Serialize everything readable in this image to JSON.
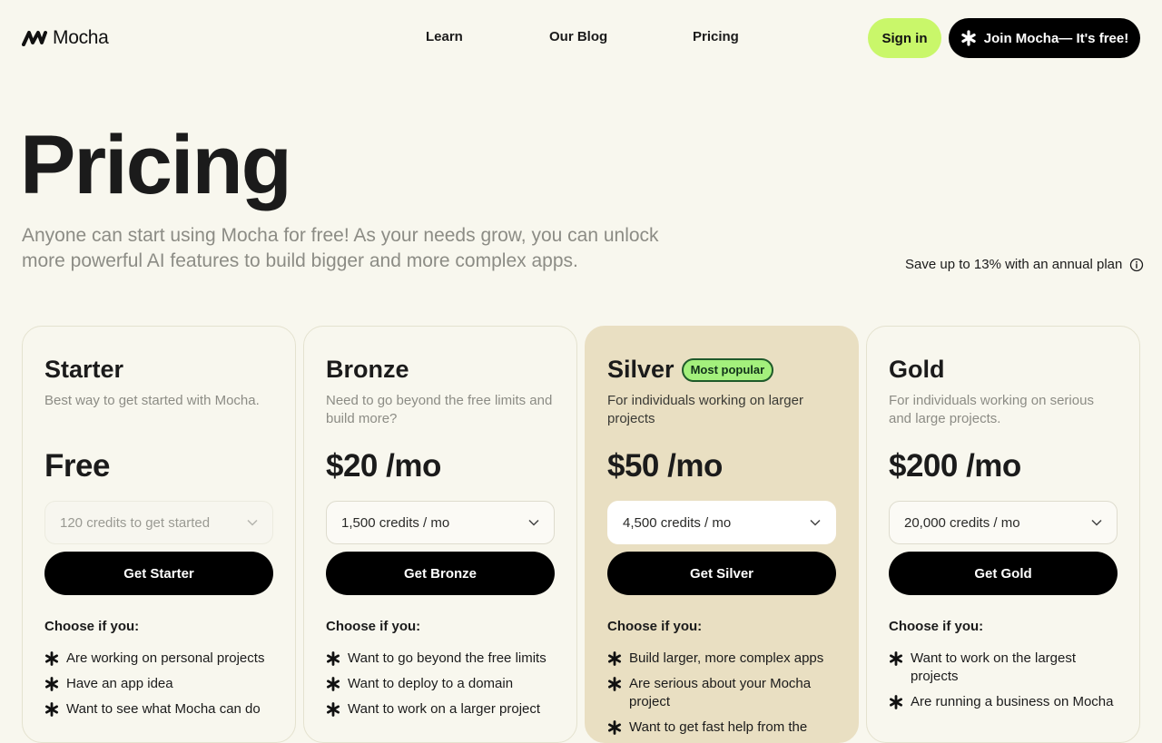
{
  "header": {
    "logo_text": "Mocha",
    "nav": [
      "Learn",
      "Our Blog",
      "Pricing"
    ],
    "signin_label": "Sign in",
    "join_label": "Join Mocha— It's free!"
  },
  "hero": {
    "title": "Pricing",
    "subtitle": "Anyone can start using Mocha for free! As your needs grow, you can unlock more powerful AI features to build bigger and more complex apps.",
    "annual_note": "Save up to 13% with an annual plan"
  },
  "plans": [
    {
      "name": "Starter",
      "description": "Best way to get started with Mocha.",
      "price": "Free",
      "credits": "120 credits to get started",
      "cta": "Get Starter",
      "choose_label": "Choose if you:",
      "features": [
        "Are working on personal projects",
        "Have an app idea",
        "Want to see what Mocha can do"
      ]
    },
    {
      "name": "Bronze",
      "description": "Need to go beyond the free limits and build more?",
      "price": "$20 /mo",
      "credits": "1,500 credits / mo",
      "cta": "Get Bronze",
      "choose_label": "Choose if you:",
      "features": [
        "Want to go beyond the free limits",
        "Want to deploy to a domain",
        "Want to work on a larger project"
      ]
    },
    {
      "name": "Silver",
      "badge": "Most popular",
      "description": "For individuals working on larger projects",
      "price": "$50 /mo",
      "credits": "4,500 credits / mo",
      "cta": "Get Silver",
      "choose_label": "Choose if you:",
      "features": [
        "Build larger, more complex apps",
        "Are serious about your Mocha project",
        "Want to get fast help from the"
      ]
    },
    {
      "name": "Gold",
      "description": "For individuals working on serious and large projects.",
      "price": "$200 /mo",
      "credits": "20,000 credits / mo",
      "cta": "Get Gold",
      "choose_label": "Choose if you:",
      "features": [
        "Want to work on the largest projects",
        "Are running a business on Mocha"
      ]
    }
  ],
  "colors": {
    "background": "#f8f7ee",
    "accent_green": "#c9f76a",
    "badge_green": "#a3f07c",
    "featured_card": "#e9dfc2",
    "button_black": "#000000"
  },
  "icons": {
    "logo": "mocha-logo-icon",
    "join": "asterisk-icon",
    "info": "info-icon",
    "bullet": "asterisk-icon",
    "select": "chevron-down-icon"
  }
}
